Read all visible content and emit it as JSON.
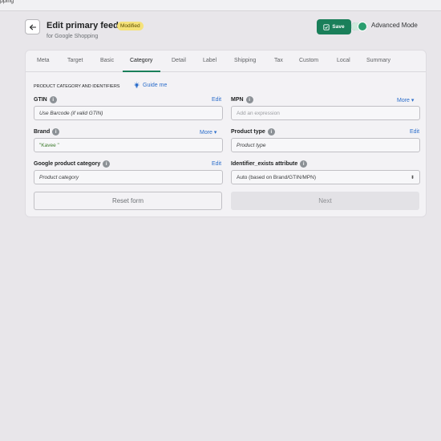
{
  "browser": {
    "tab_fragment": "pping"
  },
  "header": {
    "title": "Edit primary feed",
    "badge": "Modified",
    "subtitle": "for Google Shopping",
    "save_label": "Save",
    "advanced_mode_label": "Advanced Mode",
    "advanced_mode_on": true
  },
  "tabs": [
    {
      "label": "Meta"
    },
    {
      "label": "Target"
    },
    {
      "label": "Basic"
    },
    {
      "label": "Category",
      "active": true
    },
    {
      "label": "Detail"
    },
    {
      "label": "Label"
    },
    {
      "label": "Shipping"
    },
    {
      "label": "Tax"
    },
    {
      "label": "Custom"
    },
    {
      "label": "Local"
    },
    {
      "label": "Summary"
    }
  ],
  "section": {
    "title": "PRODUCT CATEGORY AND IDENTIFIERS",
    "guide_label": "Guide me"
  },
  "fields": {
    "gtin": {
      "label": "GTIN",
      "link": "Edit",
      "value": "Use Barcode (if valid GTIN)"
    },
    "mpn": {
      "label": "MPN",
      "link": "More",
      "placeholder": "Add an expression"
    },
    "brand": {
      "label": "Brand",
      "link": "More",
      "value": "\"Kavee \""
    },
    "product_type": {
      "label": "Product type",
      "link": "Edit",
      "value": "Product type"
    },
    "google_category": {
      "label": "Google product category",
      "link": "Edit",
      "value": "Product category"
    },
    "identifier_exists": {
      "label": "Identifier_exists attribute",
      "value": "Auto (based on Brand/GTIN/MPN)"
    }
  },
  "actions": {
    "reset_label": "Reset form",
    "next_label": "Next"
  },
  "colors": {
    "accent": "#1a7f5a",
    "link": "#2c6ecb",
    "badge": "#f5e27a"
  }
}
